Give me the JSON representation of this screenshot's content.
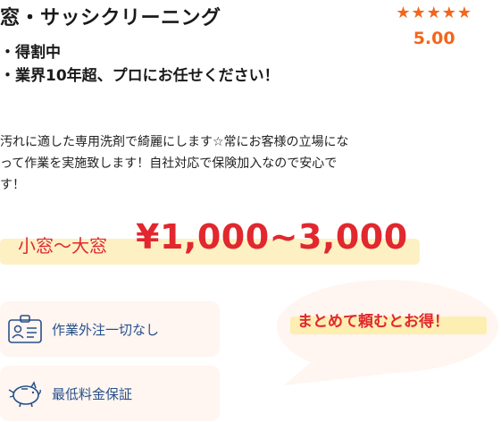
{
  "service": {
    "title": "窓・サッシクリーニング",
    "rating_stars": "★★★★★",
    "rating_value": "5.00",
    "features": [
      "・得割中",
      "・業界10年超、プロにお任せください！"
    ],
    "description": "汚れに適した専用洗剤で綺麗にします☆常にお客様の立場になって作業を実施致します！自社対応で保険加入なので安心です！",
    "price_label": "小窓～大窓",
    "price_value": "¥1,000~3,000"
  },
  "badges": [
    {
      "label": "作業外注一切なし",
      "icon": "id-badge-icon"
    },
    {
      "label": "最低料金保証",
      "icon": "piggy-bank-icon"
    }
  ],
  "callout": {
    "text": "まとめて頼むとお得！"
  },
  "colors": {
    "accent_orange": "#f2661c",
    "price_red": "#e0282e",
    "highlight_yellow": "#fdf1c4",
    "badge_bg": "#fff5f1",
    "badge_text": "#27518a"
  }
}
